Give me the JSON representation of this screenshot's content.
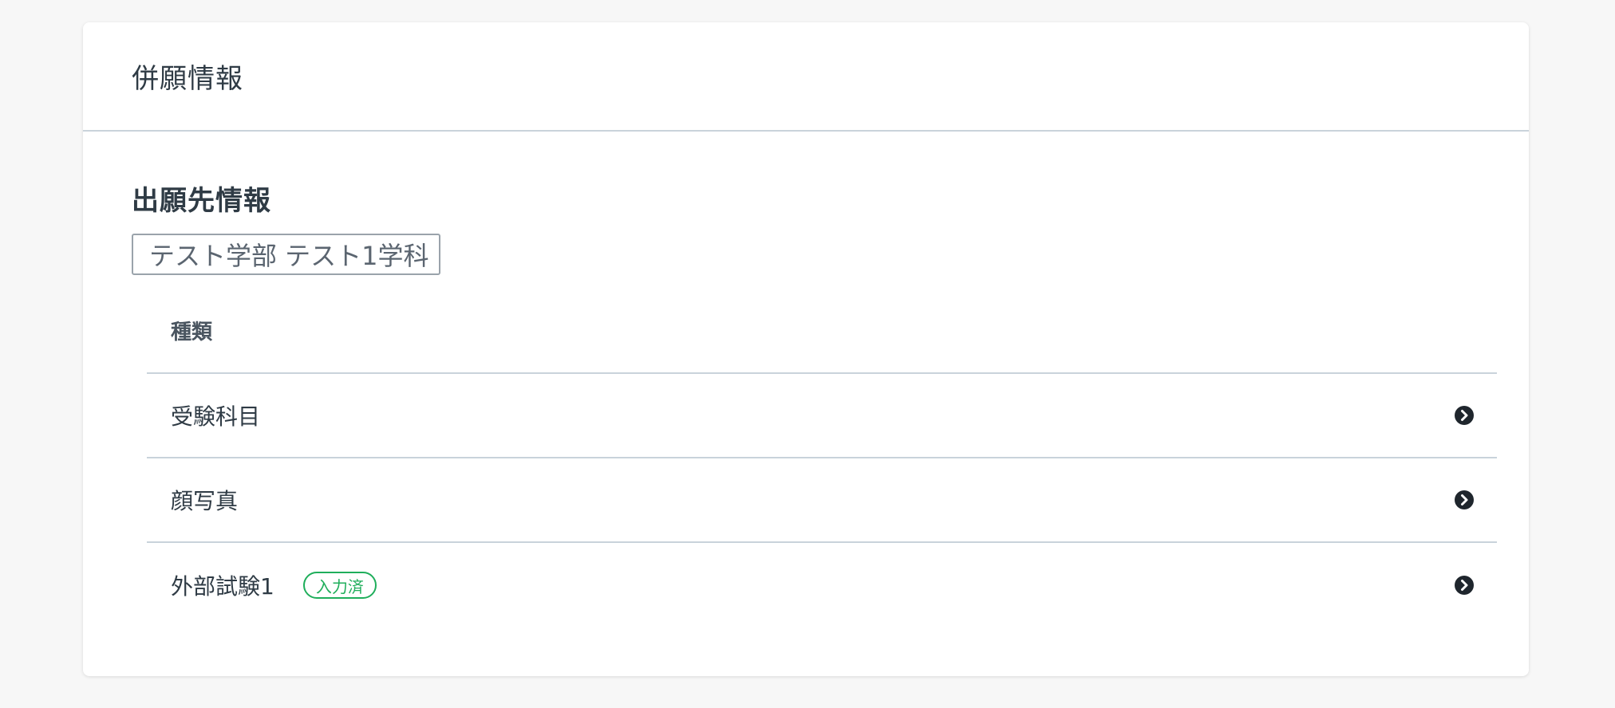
{
  "card": {
    "title": "併願情報"
  },
  "section": {
    "title": "出願先情報",
    "department_tag": "テスト学部 テスト1学科"
  },
  "table": {
    "header": "種類",
    "rows": [
      {
        "label": "受験科目",
        "badge": ""
      },
      {
        "label": "顔写真",
        "badge": ""
      },
      {
        "label": "外部試験1",
        "badge": "入力済"
      }
    ]
  },
  "icons": {
    "row_arrow": "chevron-circle-right-icon"
  },
  "colors": {
    "badge_green": "#1fae5b",
    "divider": "#c9d3db",
    "text": "#2f3b45"
  }
}
